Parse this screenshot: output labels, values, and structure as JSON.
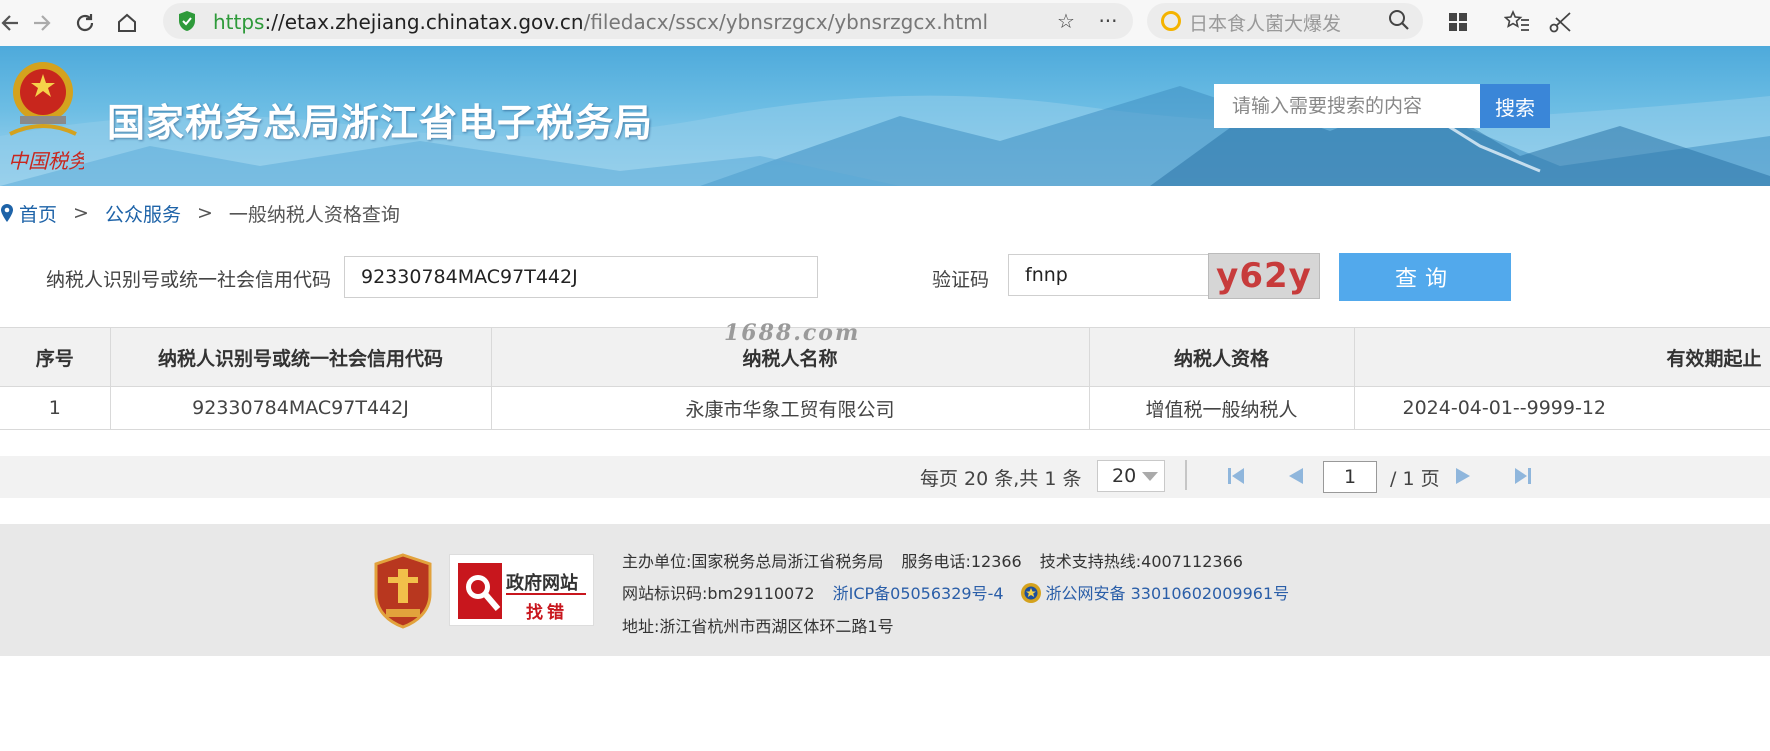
{
  "browser": {
    "url_scheme": "https",
    "url_host": "://etax.zhejiang.chinatax.gov.cn",
    "url_path": "/filedacx/sscx/ybnsrzgcx/ybnsrzgcx.html",
    "search_suggestion": "日本食人菌大爆发"
  },
  "header": {
    "site_title": "国家税务总局浙江省电子税务局",
    "search_placeholder": "请输入需要搜索的内容",
    "search_button": "搜索"
  },
  "breadcrumb": {
    "home": "首页",
    "public_service": "公众服务",
    "current": "一般纳税人资格查询",
    "separator": ">"
  },
  "form": {
    "taxpayer_id_label": "纳税人识别号或统一社会信用代码",
    "taxpayer_id_value": "92330784MAC97T442J",
    "captcha_label": "验证码",
    "captcha_value": "fnnp",
    "captcha_image_text": "y62y",
    "query_button": "查询"
  },
  "watermark": "1688.com",
  "table": {
    "headers": [
      "序号",
      "纳税人识别号或统一社会信用代码",
      "纳税人名称",
      "纳税人资格",
      "有效期起止"
    ],
    "rows": [
      [
        "1",
        "92330784MAC97T442J",
        "永康市华象工贸有限公司",
        "增值税一般纳税人",
        "2024-04-01--9999-12"
      ]
    ]
  },
  "pager": {
    "info": "每页 20 条,共 1 条",
    "page_size": "20",
    "current_page": "1",
    "total_pages": "/ 1 页"
  },
  "footer": {
    "host_label": "主办单位",
    "host_value": "国家税务总局浙江省税务局",
    "phone_label": "服务电话",
    "phone_value": "12366",
    "support_label": "技术支持热线",
    "support_value": "4007112366",
    "site_id_label": "网站标识码",
    "site_id_value": "bm29110072",
    "icp": "浙ICP备05056329号-4",
    "police": "浙公网安备 33010602009961号",
    "address_label": "地址",
    "address_value": "浙江省杭州市西湖区体环二路1号",
    "gov_badge_line1": "政府网站",
    "gov_badge_line2": "找错"
  },
  "colors": {
    "brand_blue": "#3a86d8",
    "query_button": "#52a9ec",
    "link": "#1e63a8",
    "secure_green": "#2e9a3a"
  }
}
